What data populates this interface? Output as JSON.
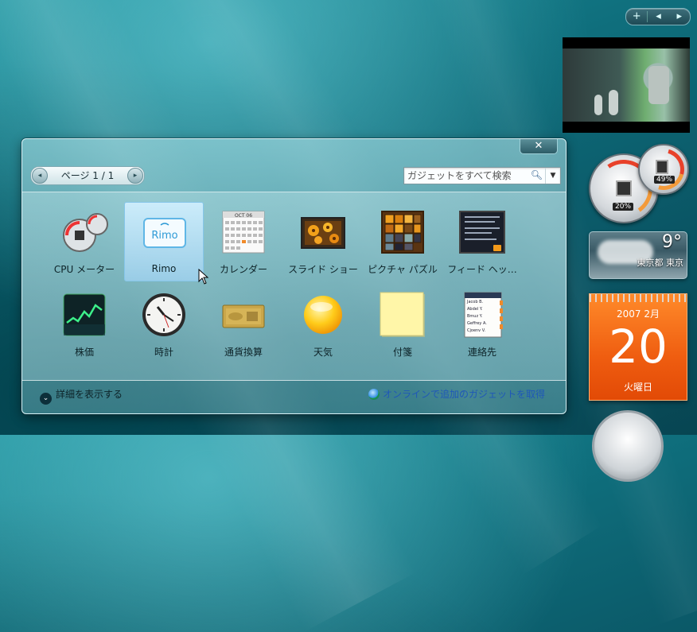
{
  "sidebar": {
    "controls": {
      "add": "+",
      "prev": "◂",
      "next": "▸"
    },
    "cpu_gadget": {
      "cpu": "20%",
      "memory": "49%"
    },
    "weather": {
      "temperature": "9°",
      "location": "東京都 東京"
    },
    "calendar": {
      "year_month": "2007 2月",
      "day": "20",
      "weekday": "火曜日"
    }
  },
  "gallery": {
    "close": "✕",
    "pager": {
      "text": "ページ 1 / 1",
      "prev": "◂",
      "next": "▸"
    },
    "search": {
      "placeholder": "ガジェットをすべて検索"
    },
    "tiles": [
      {
        "label": "CPU メーター",
        "icon": "cpu-meter-icon"
      },
      {
        "label": "Rimo",
        "icon": "rimo-icon"
      },
      {
        "label": "カレンダー",
        "icon": "calendar-icon"
      },
      {
        "label": "スライド ショー",
        "icon": "slideshow-icon"
      },
      {
        "label": "ピクチャ パズル",
        "icon": "picture-puzzle-icon"
      },
      {
        "label": "フィード ヘッ…",
        "icon": "feed-headlines-icon"
      },
      {
        "label": "株価",
        "icon": "stocks-icon"
      },
      {
        "label": "時計",
        "icon": "clock-icon"
      },
      {
        "label": "通貨換算",
        "icon": "currency-icon"
      },
      {
        "label": "天気",
        "icon": "weather-icon"
      },
      {
        "label": "付箋",
        "icon": "notes-icon"
      },
      {
        "label": "連絡先",
        "icon": "contacts-icon"
      }
    ],
    "icon_text": {
      "rimo": "Rimo",
      "calendar_header": "OCT 06",
      "contacts": [
        "Jacob B.",
        "Abdel Y.",
        "Bmuz Y.",
        "Geffrey A.",
        "Cjoenv V."
      ]
    },
    "footer": {
      "details": "詳細を表示する",
      "details_chev": "⌄",
      "online": "オンラインで追加のガジェットを取得"
    }
  },
  "colors": {
    "accent_orange": "#ef5d10",
    "link_blue": "#1f58b8",
    "selection": "#86c6ea"
  }
}
